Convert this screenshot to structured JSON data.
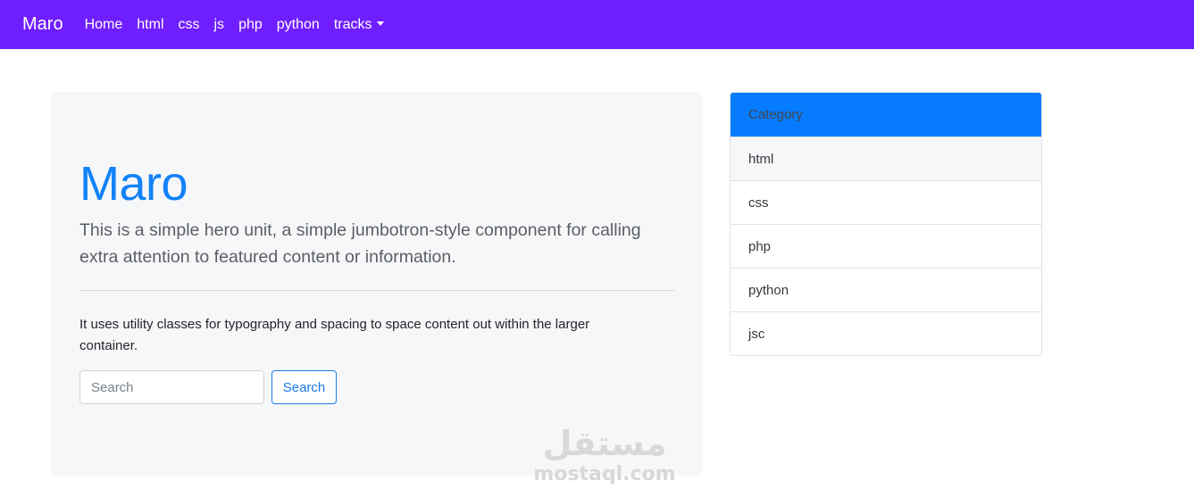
{
  "navbar": {
    "brand": "Maro",
    "links": [
      {
        "label": "Home"
      },
      {
        "label": "html"
      },
      {
        "label": "css"
      },
      {
        "label": "js"
      },
      {
        "label": "php"
      },
      {
        "label": "python"
      },
      {
        "label": "tracks"
      }
    ],
    "background": "#6f1fff"
  },
  "hero": {
    "title": "Maro",
    "lead": "This is a simple hero unit, a simple jumbotron-style component for calling extra attention to featured content or information.",
    "text": "It uses utility classes for typography and spacing to space content out within the larger container.",
    "search": {
      "placeholder": "Search",
      "value": "",
      "button_label": "Search"
    }
  },
  "category": {
    "header": "Category",
    "header_color": "#077bff",
    "items": [
      {
        "label": "html"
      },
      {
        "label": "css"
      },
      {
        "label": "php"
      },
      {
        "label": "python"
      },
      {
        "label": "jsc"
      }
    ]
  },
  "watermark": {
    "arabic": "مستقل",
    "latin": "mostaql.com"
  }
}
